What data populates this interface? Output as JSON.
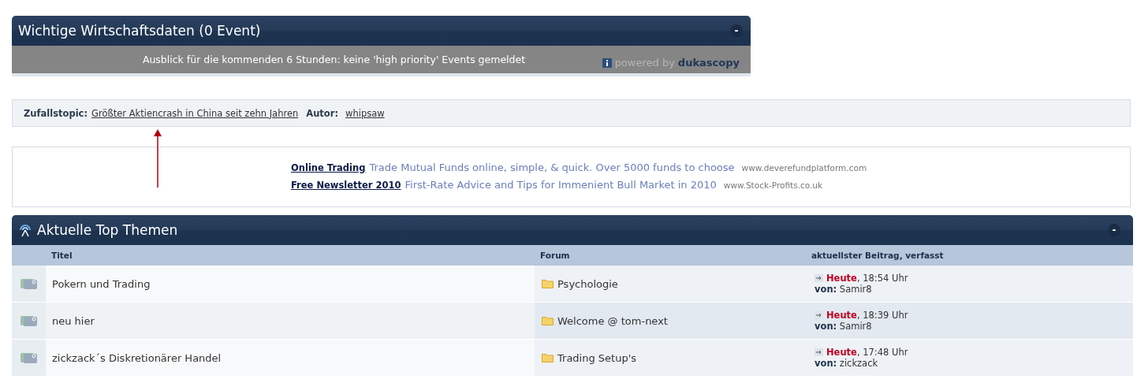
{
  "economic_panel": {
    "title": "Wichtige Wirtschaftsdaten (0 Event)",
    "collapse": "-",
    "message": "Ausblick für die kommenden 6 Stunden: keine 'high priority' Events gemeldet",
    "powered_by": "powered by",
    "provider": "dukascopy"
  },
  "random_topic": {
    "label": "Zufallstopic:",
    "topic": "Größter Aktiencrash in China seit zehn Jahren",
    "author_label": "Autor:",
    "author": "whipsaw"
  },
  "ads": [
    {
      "title": "Online Trading",
      "text": "Trade Mutual Funds online, simple, & quick. Over 5000 funds to choose",
      "url": "www.deverefundplatform.com"
    },
    {
      "title": "Free Newsletter 2010",
      "text": "First-Rate Advice and Tips for Immenient Bull Market in 2010",
      "url": "www.Stock-Profits.co.uk"
    }
  ],
  "top_topics": {
    "title": "Aktuelle Top Themen",
    "collapse": "-",
    "columns": [
      "Titel",
      "Forum",
      "aktuellster Beitrag, verfasst"
    ],
    "rows": [
      {
        "title": "Pokern und Trading",
        "forum": "Psychologie",
        "day": "Heute",
        "time": ", 18:54 Uhr",
        "by_label": "von:",
        "author": "Samir8"
      },
      {
        "title": "neu hier",
        "forum": "Welcome @ tom-next",
        "day": "Heute",
        "time": ", 18:39 Uhr",
        "by_label": "von:",
        "author": "Samir8"
      },
      {
        "title": "zickzack´s Diskretionärer Handel",
        "forum": "Trading Setup's",
        "day": "Heute",
        "time": ", 17:48 Uhr",
        "by_label": "von:",
        "author": "zickzack"
      }
    ]
  }
}
